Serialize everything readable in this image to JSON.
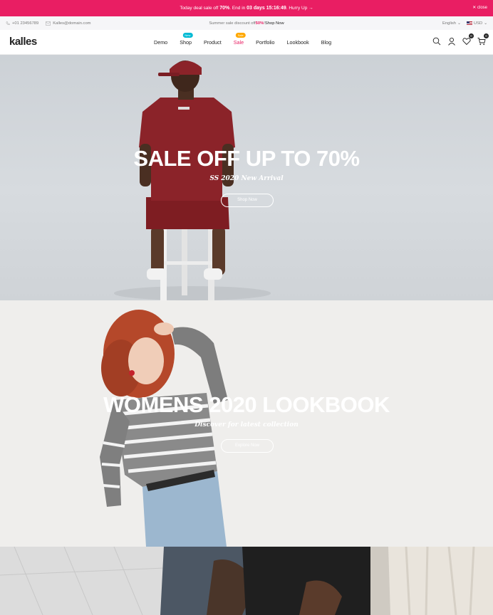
{
  "promo": {
    "text_before": "Today deal sale off ",
    "percent": "70%",
    "text_mid": ". End in ",
    "days": "03 days",
    "time": " 15:16:49",
    "text_end": ". Hurry Up →",
    "close": "✕ close"
  },
  "util": {
    "phone": "+01 23456789",
    "email": "Kalles@domain.com",
    "sale_text": "Summer sale discount off ",
    "sale_percent": "50%",
    "sale_sep": "! ",
    "shop_now": "Shop Now",
    "language": "English",
    "currency": "USD"
  },
  "header": {
    "logo": "kalles",
    "nav": [
      "Demo",
      "Shop",
      "Product",
      "Sale",
      "Portfolio",
      "Lookbook",
      "Blog"
    ],
    "badges": {
      "shop": "New",
      "sale": "Sale"
    },
    "wishlist_count": "0",
    "cart_count": "0"
  },
  "hero1": {
    "title": "SALE OFF UP TO 70%",
    "subtitle": "SS 2020 New Arrival",
    "button": "Shop Now"
  },
  "hero2": {
    "title": "WOMENS 2020 LOOKBOOK",
    "subtitle": "Discover for latest collection",
    "button": "Explore Now"
  },
  "colors": {
    "accent": "#e91e63",
    "new_badge": "#01bad4",
    "sale_badge": "#ffa800"
  }
}
